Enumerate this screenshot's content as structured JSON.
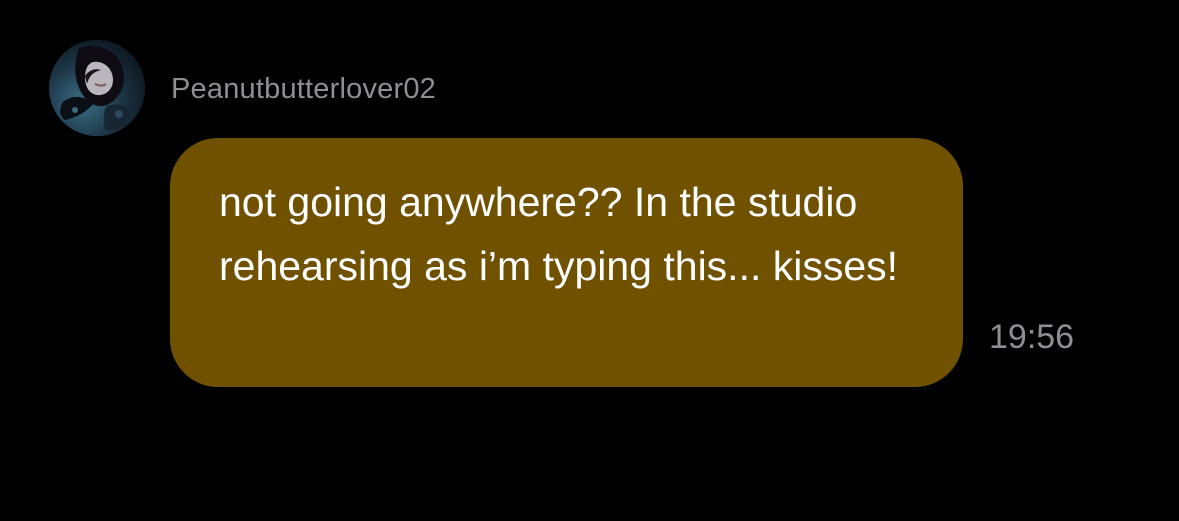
{
  "conversation": {
    "sender": {
      "username": "Peanutbutterlover02",
      "avatar_icon": "profile-photo"
    },
    "message": {
      "text": "not going anywhere?? In the studio rehearsing as i’m typing this... kisses!",
      "time": "19:56",
      "bubble_color": "#6f5100",
      "text_color": "#ffffff"
    },
    "colors": {
      "background": "#000000",
      "secondary_text": "#8e8e93"
    }
  }
}
